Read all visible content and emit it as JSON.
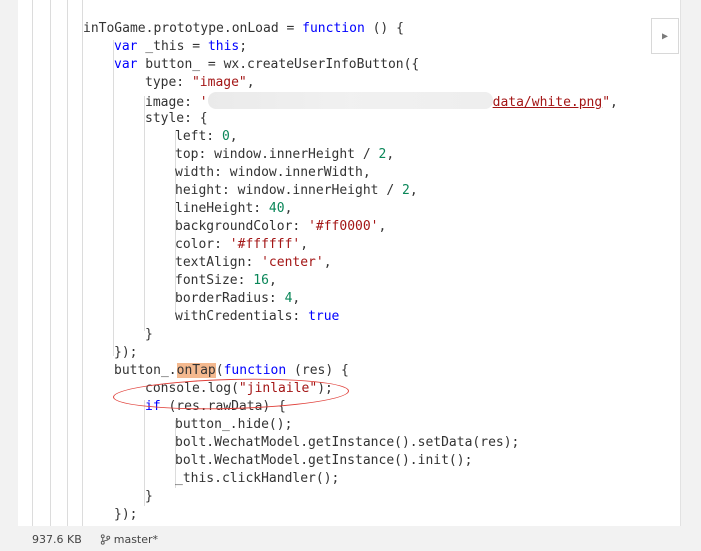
{
  "editor": {
    "lines": [
      [
        {
          "t": "inToGame.prototype.onLoad = "
        },
        {
          "t": "function",
          "c": "kw"
        },
        {
          "t": " () {"
        }
      ],
      [
        {
          "t": "var",
          "c": "kw"
        },
        {
          "t": " _this = "
        },
        {
          "t": "this",
          "c": "kw"
        },
        {
          "t": ";"
        }
      ],
      [
        {
          "t": "var",
          "c": "kw"
        },
        {
          "t": " button_ = wx.createUserInfoButton({"
        }
      ],
      [
        {
          "t": "type: "
        },
        {
          "t": "\"image\"",
          "c": "str"
        },
        {
          "t": ","
        }
      ],
      [
        {
          "t": "image: "
        },
        {
          "t": "'",
          "c": "str"
        },
        {
          "t": "",
          "c": "blur"
        },
        {
          "t": "data/white.png",
          "c": "str ul"
        },
        {
          "t": "\"",
          "c": "str"
        },
        {
          "t": ","
        }
      ],
      [
        {
          "t": "style: {"
        }
      ],
      [
        {
          "t": "left: "
        },
        {
          "t": "0",
          "c": "num"
        },
        {
          "t": ","
        }
      ],
      [
        {
          "t": "top: window.innerHeight / "
        },
        {
          "t": "2",
          "c": "num"
        },
        {
          "t": ","
        }
      ],
      [
        {
          "t": "width: window.innerWidth,"
        }
      ],
      [
        {
          "t": "height: window.innerHeight / "
        },
        {
          "t": "2",
          "c": "num"
        },
        {
          "t": ","
        }
      ],
      [
        {
          "t": "lineHeight: "
        },
        {
          "t": "40",
          "c": "num"
        },
        {
          "t": ","
        }
      ],
      [
        {
          "t": "backgroundColor: "
        },
        {
          "t": "'#ff0000'",
          "c": "str"
        },
        {
          "t": ","
        }
      ],
      [
        {
          "t": "color: "
        },
        {
          "t": "'#ffffff'",
          "c": "str"
        },
        {
          "t": ","
        }
      ],
      [
        {
          "t": "textAlign: "
        },
        {
          "t": "'center'",
          "c": "str"
        },
        {
          "t": ","
        }
      ],
      [
        {
          "t": "fontSize: "
        },
        {
          "t": "16",
          "c": "num"
        },
        {
          "t": ","
        }
      ],
      [
        {
          "t": "borderRadius: "
        },
        {
          "t": "4",
          "c": "num"
        },
        {
          "t": ","
        }
      ],
      [
        {
          "t": "withCredentials: "
        },
        {
          "t": "true",
          "c": "kw"
        }
      ],
      [
        {
          "t": "}"
        }
      ],
      [
        {
          "t": "});"
        }
      ],
      [
        {
          "t": "button_."
        },
        {
          "t": "onTap",
          "c": "hl"
        },
        {
          "t": "("
        },
        {
          "t": "function",
          "c": "kw"
        },
        {
          "t": " (res) {"
        }
      ],
      [
        {
          "t": "console.log("
        },
        {
          "t": "\"jinlaile\"",
          "c": "str"
        },
        {
          "t": ");"
        }
      ],
      [
        {
          "t": "if",
          "c": "kw"
        },
        {
          "t": " (res.rawData) {"
        }
      ],
      [
        {
          "t": "button_.hide();"
        }
      ],
      [
        {
          "t": "bolt.WechatModel.getInstance().setData(res);"
        }
      ],
      [
        {
          "t": "bolt.WechatModel.getInstance().init();"
        }
      ],
      [
        {
          "t": "_this.clickHandler();"
        }
      ],
      [
        {
          "t": "}"
        }
      ],
      [
        {
          "t": "});"
        }
      ]
    ]
  },
  "statusbar": {
    "file_size": "937.6 KB",
    "branch": "master*"
  },
  "colors": {
    "keyword": "#0000ff",
    "string": "#a31515",
    "number": "#098658",
    "highlight": "#f4b98f",
    "annotation": "#e0403a"
  },
  "icons": {
    "scroll": "chevron-right-icon",
    "branch": "git-branch-icon"
  }
}
